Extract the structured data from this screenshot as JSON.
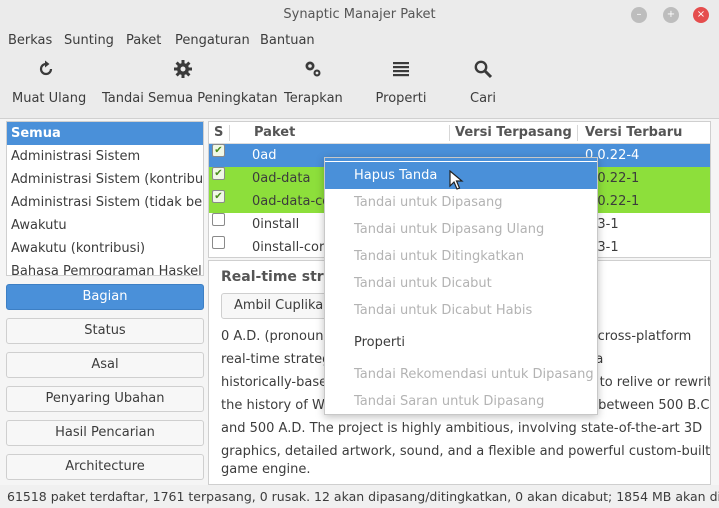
{
  "window": {
    "title": "Synaptic Manajer Paket"
  },
  "menubar": [
    "Berkas",
    "Sunting",
    "Paket",
    "Pengaturan",
    "Bantuan"
  ],
  "toolbar": [
    {
      "label": "Muat Ulang",
      "icon": "reload-icon"
    },
    {
      "label": "Tandai Semua Peningkatan",
      "icon": "gear-icon"
    },
    {
      "label": "Terapkan",
      "icon": "apply-gears-icon"
    },
    {
      "label": "Properti",
      "icon": "list-icon"
    },
    {
      "label": "Cari",
      "icon": "search-icon"
    }
  ],
  "filters": {
    "items": [
      "Semua",
      "Administrasi Sistem",
      "Administrasi Sistem (kontribusi)",
      "Administrasi Sistem (tidak bebas)",
      "Awakutu",
      "Awakutu (kontribusi)",
      "Bahasa Pemrograman Haskell"
    ],
    "selected": "Semua"
  },
  "side_buttons": [
    "Bagian",
    "Status",
    "Asal",
    "Penyaring Ubahan",
    "Hasil Pencarian",
    "Architecture"
  ],
  "table": {
    "headers": {
      "s": "S",
      "paket": "Paket",
      "installed": "Versi Terpasang",
      "latest": "Versi Terbaru"
    },
    "rows": [
      {
        "name": "0ad",
        "installed": "",
        "latest": "0.0.22-4"
      },
      {
        "name": "0ad-data",
        "installed": "",
        "latest": "0.0.22-1"
      },
      {
        "name": "0ad-data-common",
        "installed": "",
        "latest": "0.0.22-1"
      },
      {
        "name": "0install",
        "installed": "",
        "latest": "2.3-1"
      },
      {
        "name": "0install-core",
        "installed": "",
        "latest": "2.3-1"
      }
    ]
  },
  "description": {
    "title": "Real-time strategy game of ancient warfare",
    "screenshot_button": "Ambil Cuplikan Layar",
    "lines": [
      "0 A.D. (pronounced \"zero ey-dee\") is a free, open-source, cross-platform",
      "real-time strategy game of ancient warfare. In short, it is a",
      "historically-based war/economy game that allows players to relive or rewrite",
      "the history of Western civilizations, focusing on the years between 500 B.C.",
      "and 500 A.D. The project is highly ambitious, involving state-of-the-art 3D",
      "graphics, detailed artwork, sound, and a flexible and powerful custom-built",
      "game engine."
    ]
  },
  "context_menu": {
    "items": [
      "Hapus Tanda",
      "Tandai untuk Dipasang",
      "Tandai untuk Dipasang Ulang",
      "Tandai untuk Ditingkatkan",
      "Tandai untuk Dicabut",
      "Tandai untuk Dicabut Habis",
      "Properti",
      "Tandai Rekomendasi untuk Dipasang",
      "Tandai Saran untuk Dipasang"
    ]
  },
  "status": "61518 paket terdaftar, 1761 terpasang, 0 rusak. 12 akan dipasang/ditingkatkan, 0 akan dicabut; 1854 MB akan dipakai",
  "colors": {
    "accent": "#4a90d9",
    "marked": "#8ddf3b"
  }
}
